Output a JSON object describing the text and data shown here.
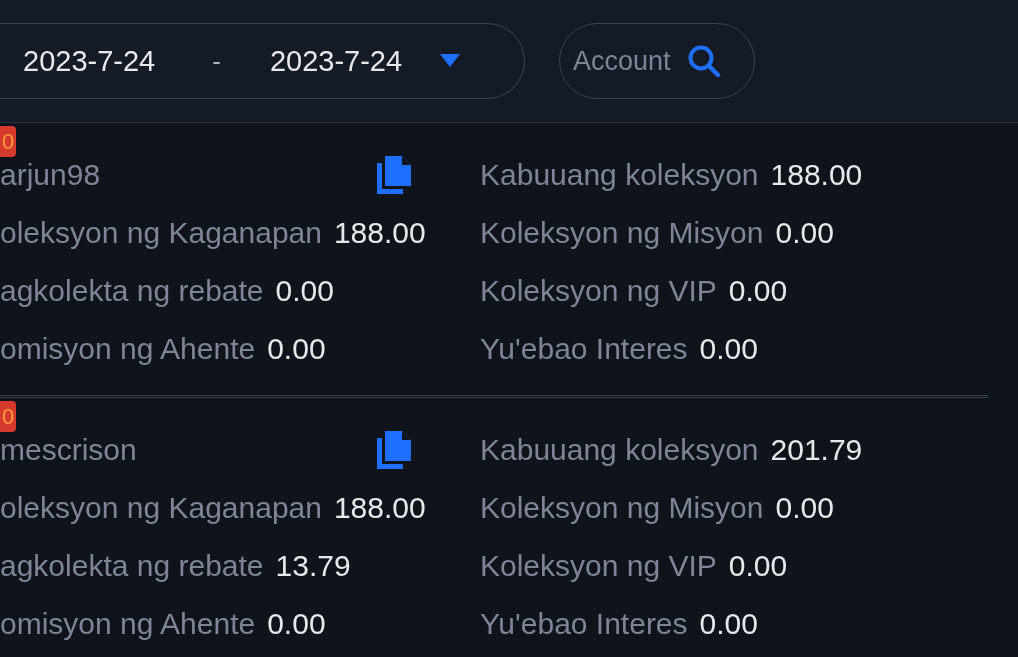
{
  "date_range": {
    "start": "2023-7-24",
    "separator": "-",
    "end": "2023-7-24"
  },
  "search": {
    "placeholder": "Account"
  },
  "records": [
    {
      "badge": "0",
      "username": "arjun98",
      "left": [
        {
          "label": "oleksyon ng Kaganapan",
          "value": "188.00"
        },
        {
          "label": "agkolekta ng rebate",
          "value": "0.00"
        },
        {
          "label": "omisyon ng Ahente",
          "value": "0.00"
        }
      ],
      "right": [
        {
          "label": "Kabuuang koleksyon",
          "value": "188.00"
        },
        {
          "label": "Koleksyon ng Misyon",
          "value": "0.00"
        },
        {
          "label": "Koleksyon ng VIP",
          "value": "0.00"
        },
        {
          "label": "Yu'ebao Interes",
          "value": "0.00"
        }
      ]
    },
    {
      "badge": "0",
      "username": "mescrison",
      "left": [
        {
          "label": "oleksyon ng Kaganapan",
          "value": "188.00"
        },
        {
          "label": "agkolekta ng rebate",
          "value": "13.79"
        },
        {
          "label": "omisyon ng Ahente",
          "value": "0.00"
        }
      ],
      "right": [
        {
          "label": "Kabuuang koleksyon",
          "value": "201.79"
        },
        {
          "label": "Koleksyon ng Misyon",
          "value": "0.00"
        },
        {
          "label": "Koleksyon ng VIP",
          "value": "0.00"
        },
        {
          "label": "Yu'ebao Interes",
          "value": "0.00"
        }
      ]
    }
  ]
}
